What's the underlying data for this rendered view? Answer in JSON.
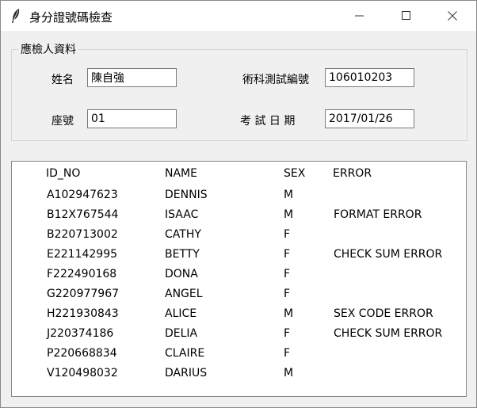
{
  "window": {
    "title": "身分證號碼檢查"
  },
  "group": {
    "title": "應檢人資料",
    "name_label": "姓名",
    "name_value": "陳自強",
    "seat_label": "座號",
    "seat_value": "01",
    "exam_label": "術科測試編號",
    "exam_value": "106010203",
    "date_label": "考 試 日 期",
    "date_value": "2017/01/26"
  },
  "table": {
    "columns": [
      "ID_NO",
      "NAME",
      "SEX",
      "ERROR"
    ],
    "rows": [
      [
        "A102947623",
        "DENNIS",
        "M",
        ""
      ],
      [
        "B12X767544",
        "ISAAC",
        "M",
        "FORMAT ERROR"
      ],
      [
        "B220713002",
        "CATHY",
        "F",
        ""
      ],
      [
        "E221142995",
        "BETTY",
        "F",
        "CHECK SUM ERROR"
      ],
      [
        "F222490168",
        "DONA",
        "F",
        ""
      ],
      [
        "G220977967",
        "ANGEL",
        "F",
        ""
      ],
      [
        "H221930843",
        "ALICE",
        "M",
        "SEX CODE ERROR"
      ],
      [
        "J220374186",
        "DELIA",
        "F",
        "CHECK SUM ERROR"
      ],
      [
        "P220668834",
        "CLAIRE",
        "F",
        ""
      ],
      [
        "V120498032",
        "DARIUS",
        "M",
        ""
      ]
    ]
  },
  "icons": {
    "app": "feather-icon",
    "minimize": "minimize-icon",
    "maximize": "maximize-icon",
    "close": "close-icon"
  }
}
